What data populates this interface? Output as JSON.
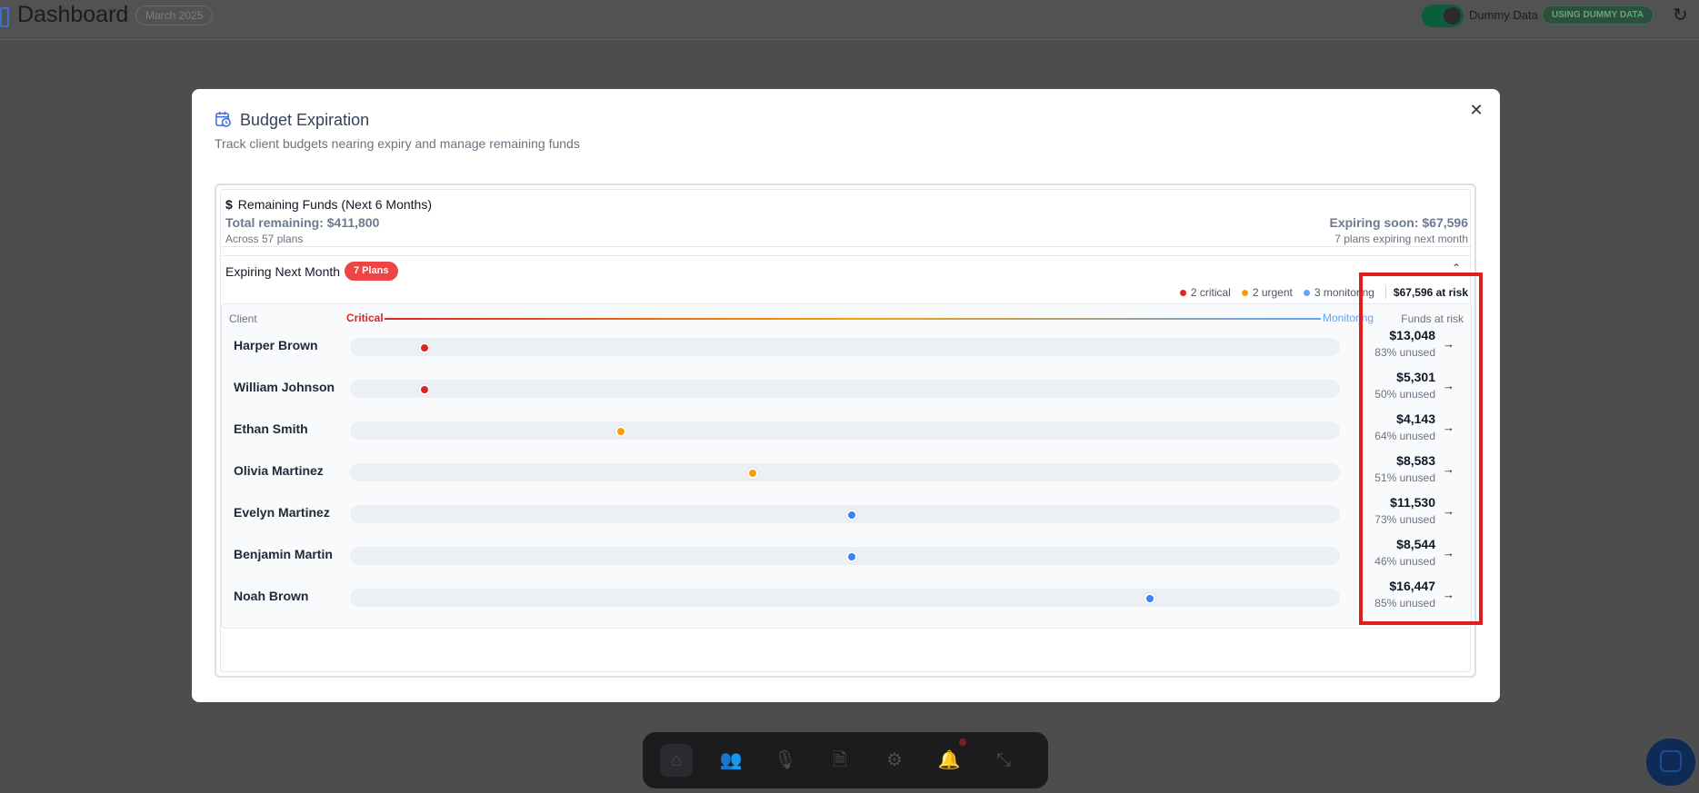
{
  "topbar": {
    "title": "Dashboard",
    "month": "March 2025",
    "toggle_state": "on",
    "dummy_label": "Dummy Data",
    "dummy_badge": "USING DUMMY DATA"
  },
  "modal": {
    "title": "Budget Expiration",
    "subtitle": "Track client budgets nearing expiry and manage remaining funds",
    "remaining": {
      "title": "Remaining Funds (Next 6 Months)",
      "total": "Total remaining: $411,800",
      "across": "Across 57 plans",
      "expiring_soon": "Expiring soon: $67,596",
      "plans_next_month": "7 plans expiring next month"
    },
    "expiring": {
      "title": "Expiring Next Month",
      "badge": "7 Plans",
      "legend": {
        "critical": "2 critical",
        "urgent": "2 urgent",
        "monitoring": "3 monitoring",
        "at_risk": "$67,596 at risk"
      },
      "headers": {
        "client": "Client",
        "critical": "Critical",
        "monitoring": "Monitoring",
        "funds": "Funds at risk"
      },
      "rows": [
        {
          "name": "Harper Brown",
          "amount": "$13,048",
          "unused": "83% unused",
          "level": "critical",
          "timeline": 0.075
        },
        {
          "name": "William Johnson",
          "amount": "$5,301",
          "unused": "50% unused",
          "level": "critical",
          "timeline": 0.075
        },
        {
          "name": "Ethan Smith",
          "amount": "$4,143",
          "unused": "64% unused",
          "level": "urgent",
          "timeline": 0.274
        },
        {
          "name": "Olivia Martinez",
          "amount": "$8,583",
          "unused": "51% unused",
          "level": "urgent",
          "timeline": 0.407
        },
        {
          "name": "Evelyn Martinez",
          "amount": "$11,530",
          "unused": "73% unused",
          "level": "monitoring",
          "timeline": 0.507
        },
        {
          "name": "Benjamin Martin",
          "amount": "$8,544",
          "unused": "46% unused",
          "level": "monitoring",
          "timeline": 0.507
        },
        {
          "name": "Noah Brown",
          "amount": "$16,447",
          "unused": "85% unused",
          "level": "monitoring",
          "timeline": 0.808
        }
      ]
    }
  },
  "colors": {
    "critical": "#dc2626",
    "urgent": "#f59e0b",
    "monitoring": "#3b82f6",
    "highlight": "#e11d1d"
  },
  "dock": {
    "icons": [
      "home-icon",
      "users-icon",
      "microphone-icon",
      "document-icon",
      "gear-icon",
      "bell-icon",
      "minimize-icon"
    ],
    "active": "home-icon"
  }
}
